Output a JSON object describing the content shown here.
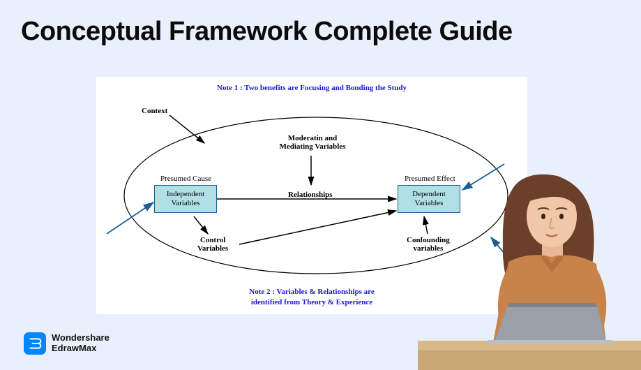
{
  "header": {
    "title": "Conceptual Framework Complete Guide"
  },
  "diagram": {
    "note1": "Note 1 : Two benefits are Focusing and Bonding the Study",
    "note2_line1": "Note 2 : Variables & Relationships are",
    "note2_line2": "identified from Theory & Experience",
    "context": "Context",
    "moderating": "Moderatin and\nMediating Variables",
    "presumed_cause": "Presumed Cause",
    "presumed_effect": "Presumed Effect",
    "independent": "Independent\nVariables",
    "dependent": "Dependent\nVariables",
    "relationships": "Relationships",
    "control": "Control\nVariables",
    "confounding": "Confounding\nvariables"
  },
  "brand": {
    "line1": "Wondershare",
    "line2": "EdrawMax"
  }
}
